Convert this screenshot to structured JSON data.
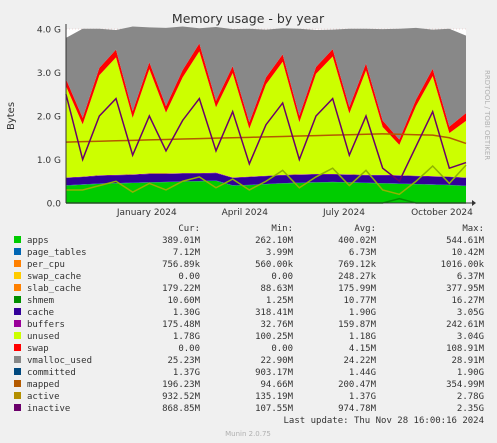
{
  "chart_data": {
    "type": "area",
    "title": "Memory usage - by year",
    "ylabel": "Bytes",
    "side_text": "RRDTOOL / TOBI OETIKER",
    "ylim": [
      0,
      4.0
    ],
    "y_unit": "G",
    "y_ticks": [
      "0.0",
      "1.0 G",
      "2.0 G",
      "3.0 G",
      "4.0 G"
    ],
    "x_ticks": [
      "January 2024",
      "April 2024",
      "July 2024",
      "October 2024"
    ],
    "grid": true,
    "colors": {
      "apps": "#00cc00",
      "page_tables": "#0066b3",
      "per_cpu": "#ff8000",
      "swap_cache": "#ffcc00",
      "slab_cache": "#330099",
      "shmem": "#990099",
      "cache": "#ccff00",
      "buffers": "#ff0000",
      "unused": "#888888",
      "swap": "#008f00",
      "vmalloc_used": "#00487d",
      "committed": "#b35a00",
      "mapped": "#b38f00",
      "active": "#6b006b",
      "inactive": "#8fb300"
    },
    "legend_header": [
      "Cur:",
      "Min:",
      "Avg:",
      "Max:"
    ],
    "legend": [
      {
        "name": "apps",
        "color": "#00cc00",
        "cur": "389.01M",
        "min": "262.10M",
        "avg": "400.02M",
        "max": "544.61M"
      },
      {
        "name": "page_tables",
        "color": "#0066b3",
        "cur": "7.12M",
        "min": "3.99M",
        "avg": "6.73M",
        "max": "10.42M"
      },
      {
        "name": "per_cpu",
        "color": "#ff8000",
        "cur": "756.89k",
        "min": "560.00k",
        "avg": "769.12k",
        "max": "1016.00k"
      },
      {
        "name": "swap_cache",
        "color": "#ffcc00",
        "cur": "0.00",
        "min": "0.00",
        "avg": "248.27k",
        "max": "6.37M"
      },
      {
        "name": "slab_cache",
        "color": "#ff8000",
        "cur": "179.22M",
        "min": "88.63M",
        "avg": "175.99M",
        "max": "377.95M"
      },
      {
        "name": "shmem",
        "color": "#008f00",
        "cur": "10.60M",
        "min": "1.25M",
        "avg": "10.77M",
        "max": "16.27M"
      },
      {
        "name": "cache",
        "color": "#330099",
        "cur": "1.30G",
        "min": "318.41M",
        "avg": "1.90G",
        "max": "3.05G"
      },
      {
        "name": "buffers",
        "color": "#990099",
        "cur": "175.48M",
        "min": "32.76M",
        "avg": "159.87M",
        "max": "242.61M"
      },
      {
        "name": "unused",
        "color": "#ccff00",
        "cur": "1.78G",
        "min": "100.25M",
        "avg": "1.18G",
        "max": "3.04G"
      },
      {
        "name": "swap",
        "color": "#ff0000",
        "cur": "0.00",
        "min": "0.00",
        "avg": "4.15M",
        "max": "108.91M"
      },
      {
        "name": "vmalloc_used",
        "color": "#888888",
        "cur": "25.23M",
        "min": "22.90M",
        "avg": "24.22M",
        "max": "28.91M"
      },
      {
        "name": "committed",
        "color": "#00487d",
        "cur": "1.37G",
        "min": "903.17M",
        "avg": "1.44G",
        "max": "1.90G"
      },
      {
        "name": "mapped",
        "color": "#b35a00",
        "cur": "196.23M",
        "min": "94.66M",
        "avg": "200.47M",
        "max": "354.99M"
      },
      {
        "name": "active",
        "color": "#b38f00",
        "cur": "932.52M",
        "min": "135.19M",
        "avg": "1.37G",
        "max": "2.78G"
      },
      {
        "name": "inactive",
        "color": "#6b006b",
        "cur": "868.85M",
        "min": "107.55M",
        "avg": "974.78M",
        "max": "2.35G"
      }
    ],
    "stack_series": [
      {
        "name": "apps",
        "values": [
          0.4,
          0.42,
          0.44,
          0.45,
          0.46,
          0.47,
          0.48,
          0.49,
          0.5,
          0.51,
          0.4,
          0.41,
          0.43,
          0.45,
          0.46,
          0.47,
          0.48,
          0.47,
          0.46,
          0.45,
          0.44,
          0.43,
          0.42,
          0.41,
          0.39
        ]
      },
      {
        "name": "page_tables",
        "values": [
          0.007,
          0.007,
          0.007,
          0.007,
          0.007,
          0.007,
          0.007,
          0.007,
          0.007,
          0.007,
          0.007,
          0.007,
          0.007,
          0.007,
          0.007,
          0.007,
          0.007,
          0.007,
          0.007,
          0.007,
          0.007,
          0.007,
          0.007,
          0.007,
          0.007
        ]
      },
      {
        "name": "slab_cache",
        "values": [
          0.17,
          0.17,
          0.18,
          0.18,
          0.18,
          0.19,
          0.18,
          0.18,
          0.17,
          0.17,
          0.17,
          0.18,
          0.18,
          0.18,
          0.18,
          0.18,
          0.17,
          0.17,
          0.17,
          0.18,
          0.18,
          0.18,
          0.18,
          0.18,
          0.18
        ]
      },
      {
        "name": "shmem",
        "values": [
          0.01,
          0.01,
          0.01,
          0.01,
          0.01,
          0.01,
          0.01,
          0.01,
          0.01,
          0.01,
          0.01,
          0.01,
          0.01,
          0.01,
          0.01,
          0.01,
          0.01,
          0.01,
          0.01,
          0.01,
          0.01,
          0.01,
          0.01,
          0.01,
          0.01
        ]
      },
      {
        "name": "cache",
        "values": [
          2.1,
          1.2,
          2.3,
          2.7,
          1.3,
          2.4,
          1.4,
          2.2,
          2.8,
          1.5,
          2.4,
          1.1,
          2.1,
          2.6,
          1.2,
          2.3,
          2.7,
          1.4,
          2.4,
          1.1,
          0.7,
          1.6,
          2.3,
          1.0,
          1.3
        ]
      },
      {
        "name": "buffers",
        "values": [
          0.16,
          0.15,
          0.17,
          0.18,
          0.15,
          0.16,
          0.15,
          0.17,
          0.18,
          0.15,
          0.16,
          0.15,
          0.16,
          0.17,
          0.15,
          0.16,
          0.17,
          0.15,
          0.16,
          0.15,
          0.12,
          0.15,
          0.17,
          0.15,
          0.18
        ]
      },
      {
        "name": "unused",
        "values": [
          0.95,
          2.05,
          0.9,
          0.45,
          1.95,
          0.8,
          1.8,
          1.0,
          0.35,
          1.7,
          0.85,
          2.15,
          1.1,
          0.6,
          2.0,
          0.85,
          0.45,
          1.8,
          0.8,
          2.1,
          2.55,
          1.65,
          0.9,
          2.25,
          1.78
        ]
      }
    ],
    "line_series": [
      {
        "name": "committed",
        "values": [
          1.4,
          1.41,
          1.42,
          1.43,
          1.44,
          1.45,
          1.46,
          1.47,
          1.48,
          1.49,
          1.5,
          1.51,
          1.52,
          1.53,
          1.54,
          1.55,
          1.56,
          1.57,
          1.58,
          1.59,
          1.58,
          1.57,
          1.56,
          1.5,
          1.37
        ]
      },
      {
        "name": "active",
        "values": [
          2.5,
          1.0,
          2.0,
          2.4,
          1.1,
          2.0,
          1.2,
          1.9,
          2.4,
          1.2,
          2.1,
          0.9,
          1.8,
          2.3,
          1.0,
          2.0,
          2.4,
          1.1,
          2.0,
          0.8,
          0.5,
          1.3,
          2.1,
          0.8,
          0.93
        ]
      },
      {
        "name": "inactive",
        "values": [
          0.3,
          0.3,
          0.4,
          0.5,
          0.25,
          0.45,
          0.3,
          0.5,
          0.6,
          0.35,
          0.55,
          0.3,
          0.5,
          0.75,
          0.35,
          0.6,
          0.8,
          0.4,
          0.75,
          0.3,
          0.2,
          0.5,
          0.85,
          0.45,
          0.87
        ]
      },
      {
        "name": "swap",
        "values": [
          0,
          0,
          0,
          0,
          0,
          0,
          0,
          0,
          0,
          0,
          0,
          0,
          0,
          0,
          0,
          0,
          0,
          0,
          0,
          0,
          0.1,
          0,
          0,
          0,
          0
        ]
      }
    ],
    "footer_update": "Last update: Thu Nov 28 16:00:16 2024",
    "footer_version": "Munin 2.0.75"
  }
}
